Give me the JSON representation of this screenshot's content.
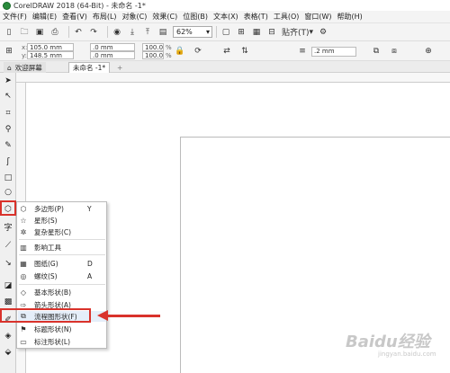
{
  "window": {
    "title": "CorelDRAW 2018 (64-Bit) - 未命名 -1*"
  },
  "menu": [
    "文件(F)",
    "编辑(E)",
    "查看(V)",
    "布局(L)",
    "对象(C)",
    "效果(C)",
    "位图(B)",
    "文本(X)",
    "表格(T)",
    "工具(O)",
    "窗口(W)",
    "帮助(H)"
  ],
  "toolbar": {
    "zoom": "62%",
    "snap_label": "贴齐(T)"
  },
  "property_bar": {
    "x": "105.0 mm",
    "y": "148.5 mm",
    "width": ".0 mm",
    "height": ".0 mm",
    "scale_w": "100.0",
    "scale_h": "100.0",
    "scale_unit": "%",
    "outline": ".2 mm"
  },
  "tabs": {
    "welcome": "欢迎屏幕",
    "document": "未命名 -1*"
  },
  "flyout": {
    "items": [
      {
        "icon": "polygon-icon",
        "label": "多边形(P)",
        "shortcut": "Y"
      },
      {
        "icon": "star-icon",
        "label": "星形(S)",
        "shortcut": ""
      },
      {
        "icon": "complex-star-icon",
        "label": "复杂星形(C)",
        "shortcut": ""
      },
      {
        "icon": "",
        "label": "影响工具",
        "shortcut": ""
      },
      {
        "icon": "graph-paper-icon",
        "label": "图纸(G)",
        "shortcut": "D"
      },
      {
        "icon": "spiral-icon",
        "label": "螺纹(S)",
        "shortcut": "A"
      },
      {
        "icon": "basic-shapes-icon",
        "label": "基本形状(B)",
        "shortcut": ""
      },
      {
        "icon": "arrow-shapes-icon",
        "label": "箭头形状(A)",
        "shortcut": ""
      },
      {
        "icon": "flowchart-shapes-icon",
        "label": "流程图形状(F)",
        "shortcut": ""
      },
      {
        "icon": "banner-shapes-icon",
        "label": "标题形状(N)",
        "shortcut": ""
      },
      {
        "icon": "callout-shapes-icon",
        "label": "标注形状(L)",
        "shortcut": ""
      }
    ]
  },
  "toolbox": {
    "text_tool": "字"
  },
  "watermark": {
    "text": "Baidu经验",
    "sub": "jingyan.baidu.com"
  },
  "colors": {
    "highlight": "#d9322b"
  }
}
